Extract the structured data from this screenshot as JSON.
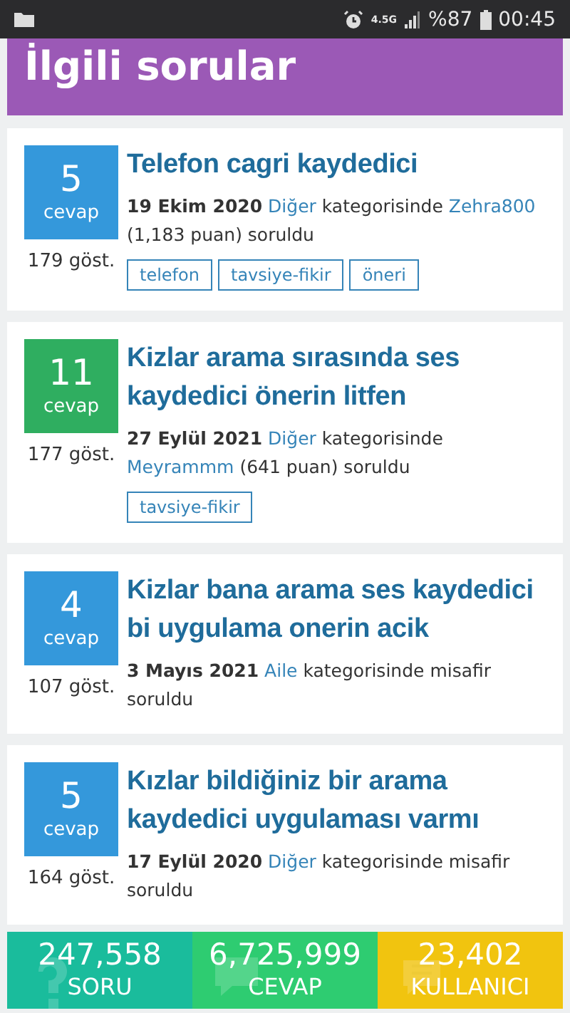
{
  "status_bar": {
    "network": "4.5G",
    "battery": "%87",
    "time": "00:45"
  },
  "header": {
    "title": "İlgili sorular"
  },
  "questions": [
    {
      "count": "5",
      "count_label": "cevap",
      "color": "#3498db",
      "views": "179 göst.",
      "title": "Telefon cagri kaydedici",
      "meta": [
        {
          "kind": "date",
          "text": "19 Ekim 2020"
        },
        {
          "kind": "link",
          "text": "Diğer"
        },
        {
          "kind": "text",
          "text": "kategorisinde"
        },
        {
          "kind": "link",
          "text": "Zehra800"
        },
        {
          "kind": "text",
          "text": "(1,183 puan) soruldu"
        }
      ],
      "tags": [
        "telefon",
        "tavsiye-fikir",
        "öneri"
      ]
    },
    {
      "count": "11",
      "count_label": "cevap",
      "color": "#2fae60",
      "views": "177 göst.",
      "title": "Kizlar arama sırasında ses kaydedici önerin litfen",
      "meta": [
        {
          "kind": "date",
          "text": "27 Eylül 2021"
        },
        {
          "kind": "link",
          "text": "Diğer"
        },
        {
          "kind": "text",
          "text": "kategorisinde"
        },
        {
          "kind": "link",
          "text": "Meyrammm"
        },
        {
          "kind": "text",
          "text": "(641 puan) soruldu"
        }
      ],
      "tags": [
        "tavsiye-fikir"
      ]
    },
    {
      "count": "4",
      "count_label": "cevap",
      "color": "#3498db",
      "views": "107 göst.",
      "title": "Kizlar bana arama ses kaydedici bi uygulama onerin acik",
      "meta": [
        {
          "kind": "date",
          "text": "3 Mayıs 2021"
        },
        {
          "kind": "link",
          "text": "Aile"
        },
        {
          "kind": "text",
          "text": "kategorisinde misafir soruldu"
        }
      ]
    },
    {
      "count": "5",
      "count_label": "cevap",
      "color": "#3498db",
      "views": "164 göst.",
      "title": "Kızlar bildiğiniz bir arama kaydedici uygulaması varmı",
      "meta": [
        {
          "kind": "date",
          "text": "17 Eylül 2020"
        },
        {
          "kind": "link",
          "text": "Diğer"
        },
        {
          "kind": "text",
          "text": "kategorisinde misafir soruldu"
        }
      ]
    }
  ],
  "stats": [
    {
      "value": "247,558",
      "label": "SORU",
      "color": "#1abc9c",
      "kind": "question"
    },
    {
      "value": "6,725,999",
      "label": "CEVAP",
      "color": "#2ecc71",
      "kind": "answer"
    },
    {
      "value": "23,402",
      "label": "KULLANICI",
      "color": "#f1c40f",
      "kind": "chat"
    }
  ]
}
